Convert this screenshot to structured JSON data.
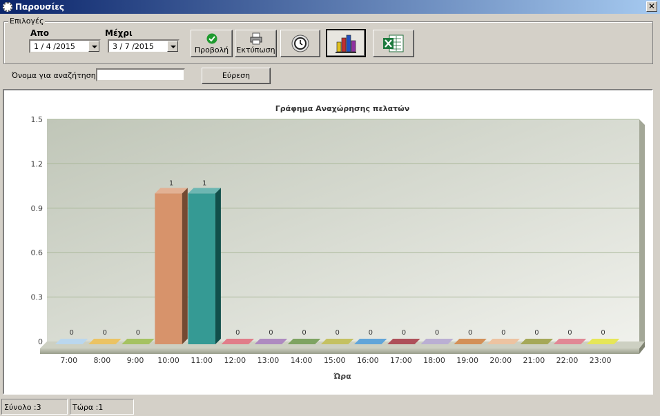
{
  "window": {
    "title": "Παρουσίες"
  },
  "options": {
    "group_label": "Επιλογές",
    "from_label": "Απο",
    "from_value": "1 / 4 /2015",
    "to_label": "Μέχρι",
    "to_value": "3 / 7 /2015"
  },
  "toolbar": {
    "view_label": "Προβολή",
    "print_label": "Εκτύπωση"
  },
  "search": {
    "label": "Όνομα για αναζήτηση",
    "value": "",
    "find_label": "Εύρεση"
  },
  "status": {
    "total": "Σύνολο :3",
    "now": "Τώρα :1"
  },
  "chart_data": {
    "type": "bar",
    "title": "Γράφημα Αναχώρησης πελατών",
    "xlabel": "Ώρα",
    "ylabel": "",
    "ylim": [
      0,
      1.5
    ],
    "yticks": [
      "0",
      "0.3",
      "0.6",
      "0.9",
      "1.2",
      "1.5"
    ],
    "categories": [
      "7:00",
      "8:00",
      "9:00",
      "10:00",
      "11:00",
      "12:00",
      "13:00",
      "14:00",
      "15:00",
      "16:00",
      "17:00",
      "18:00",
      "19:00",
      "20:00",
      "21:00",
      "22:00",
      "23:00"
    ],
    "values": [
      0,
      0,
      0,
      1,
      1,
      0,
      0,
      0,
      0,
      0,
      0,
      0,
      0,
      0,
      0,
      0,
      0
    ],
    "colors": [
      "#a9cdea",
      "#e6b43c",
      "#8fb33a",
      "#d2875a",
      "#1f8f88",
      "#d95c6b",
      "#9a6db0",
      "#5e8c3a",
      "#b5b23a",
      "#3a8fd0",
      "#9a2430",
      "#a99bc8",
      "#c8742e",
      "#e8b48a",
      "#8f922e",
      "#d96a7a",
      "#e0e02e"
    ],
    "grid": true,
    "legend": "none"
  }
}
